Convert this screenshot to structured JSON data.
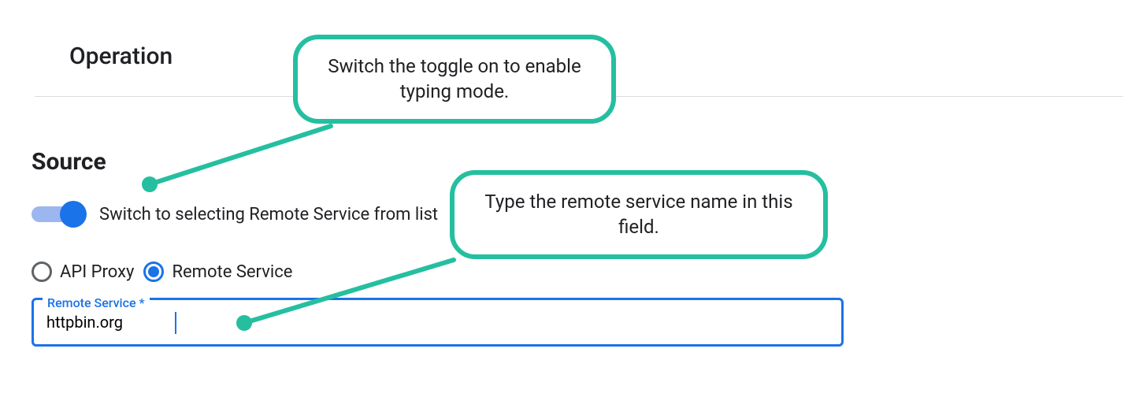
{
  "headers": {
    "operation": "Operation",
    "source": "Source"
  },
  "toggle": {
    "label": "Switch to selecting Remote Service from list"
  },
  "radios": {
    "api_proxy": "API Proxy",
    "remote_service": "Remote Service"
  },
  "field": {
    "label": "Remote Service *",
    "value": "httpbin.org"
  },
  "callouts": {
    "toggle_hint": "Switch the toggle on to enable typing mode.",
    "field_hint": "Type the remote service name in this field."
  }
}
